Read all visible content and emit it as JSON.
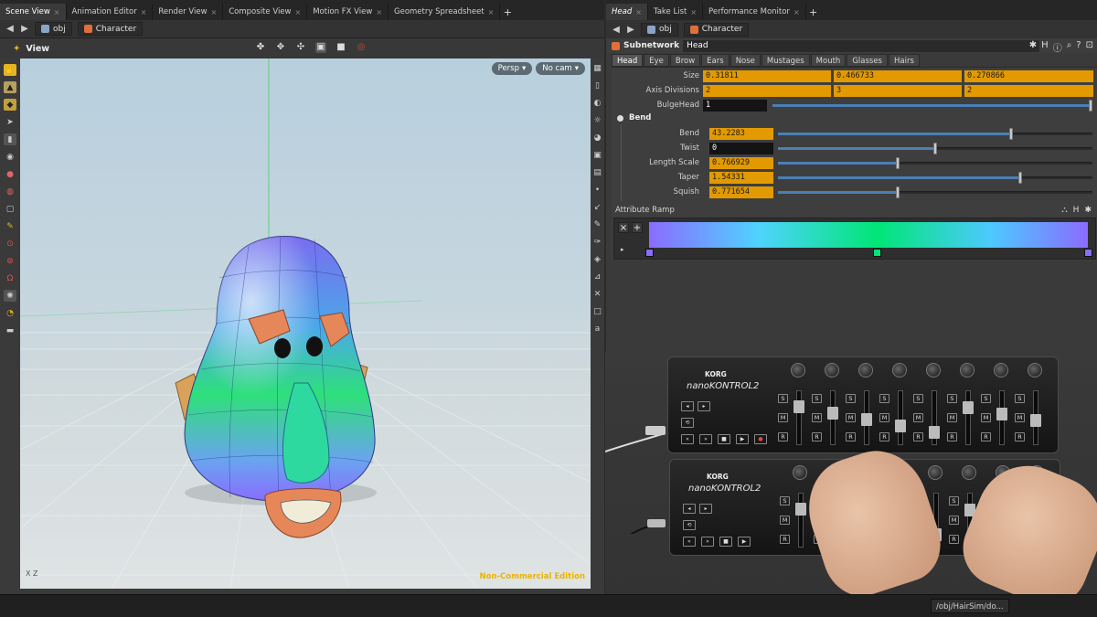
{
  "left_pane": {
    "tabs": [
      {
        "label": "Scene View"
      },
      {
        "label": "Animation Editor"
      },
      {
        "label": "Render View"
      },
      {
        "label": "Composite View"
      },
      {
        "label": "Motion FX View"
      },
      {
        "label": "Geometry Spreadsheet"
      }
    ],
    "path": {
      "root": "obj",
      "node": "Character"
    },
    "viewport_title": "View",
    "camera": {
      "projection": "Persp",
      "camera": "No cam"
    },
    "axis_label": "X Z",
    "watermark": "Non-Commercial Edition"
  },
  "right_pane": {
    "tabs": [
      {
        "label": "Head"
      },
      {
        "label": "Take List"
      },
      {
        "label": "Performance Monitor"
      }
    ],
    "path": {
      "root": "obj",
      "node": "Character"
    },
    "node_type": "Subnetwork",
    "node_name": "Head",
    "param_tabs": [
      "Head",
      "Eye",
      "Brow",
      "Ears",
      "Nose",
      "Mustages",
      "Mouth",
      "Glasses",
      "Hairs"
    ],
    "params": {
      "size": {
        "label": "Size",
        "values": [
          "0.31811",
          "0.466733",
          "0.270866"
        ]
      },
      "axis_divisions": {
        "label": "Axis Divisions",
        "values": [
          "2",
          "3",
          "2"
        ]
      },
      "bulge_head": {
        "label": "BulgeHead",
        "value": "1",
        "slider": 1.0
      },
      "bend_folder": "Bend",
      "bend": {
        "label": "Bend",
        "value": "43.2283",
        "slider": 0.74
      },
      "twist": {
        "label": "Twist",
        "value": "0",
        "slider": 0.5
      },
      "length_scale": {
        "label": "Length Scale",
        "value": "0.766929",
        "slider": 0.38
      },
      "taper": {
        "label": "Taper",
        "value": "1.54331",
        "slider": 0.77
      },
      "squish": {
        "label": "Squish",
        "value": "0.771654",
        "slider": 0.38
      }
    },
    "ramp": {
      "label": "Attribute Ramp",
      "colors": [
        "#8a6cff",
        "#00e676",
        "#8a6cff"
      ],
      "key_positions": [
        0.0,
        0.52,
        1.0
      ]
    }
  },
  "controller": {
    "brand": "KORG",
    "model": "nanoKONTROL2",
    "buttons": {
      "s": "S",
      "m": "M",
      "r": "R"
    }
  },
  "status_bar": {
    "path": "/obj/HairSim/do..."
  },
  "colors": {
    "accent_field": "#e29a00",
    "watermark": "#e8b400"
  }
}
